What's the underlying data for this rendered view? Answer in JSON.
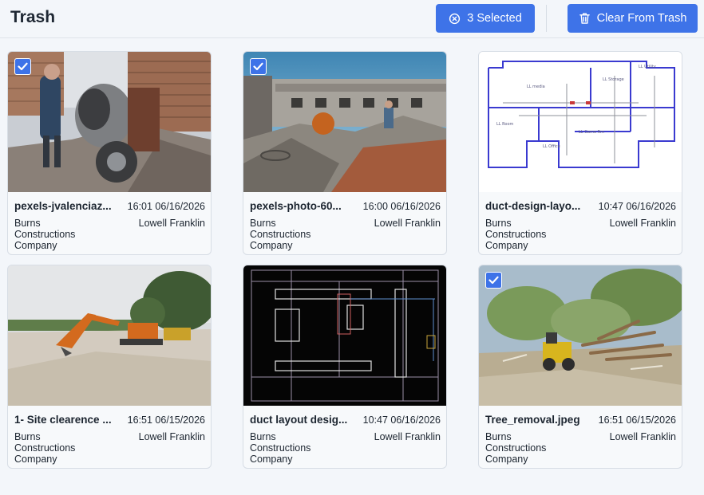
{
  "header": {
    "title": "Trash",
    "selected_label": "3 Selected",
    "clear_label": "Clear From Trash"
  },
  "colors": {
    "accent": "#3e73e8",
    "background": "#f3f6fa"
  },
  "files": [
    {
      "name": "pexels-jvalenciaz...",
      "timestamp": "16:01 06/16/2026",
      "company": "Burns Constructions Company",
      "owner": "Lowell Franklin",
      "selected": true,
      "thumbnail": "cement-mixer-photo"
    },
    {
      "name": "pexels-photo-60...",
      "timestamp": "16:00 06/16/2026",
      "company": "Burns Constructions Company",
      "owner": "Lowell Franklin",
      "selected": true,
      "thumbnail": "construction-site-photo"
    },
    {
      "name": "duct-design-layo...",
      "timestamp": "10:47 06/16/2026",
      "company": "Burns Constructions Company",
      "owner": "Lowell Franklin",
      "selected": false,
      "thumbnail": "floor-plan-drawing"
    },
    {
      "name": "1- Site clearence ...",
      "timestamp": "16:51 06/15/2026",
      "company": "Burns Constructions Company",
      "owner": "Lowell Franklin",
      "selected": false,
      "thumbnail": "excavator-photo"
    },
    {
      "name": "duct layout desig...",
      "timestamp": "10:47 06/16/2026",
      "company": "Burns Constructions Company",
      "owner": "Lowell Franklin",
      "selected": false,
      "thumbnail": "cad-drawing"
    },
    {
      "name": "Tree_removal.jpeg",
      "timestamp": "16:51 06/15/2026",
      "company": "Burns Constructions Company",
      "owner": "Lowell Franklin",
      "selected": true,
      "thumbnail": "tree-removal-photo"
    }
  ]
}
